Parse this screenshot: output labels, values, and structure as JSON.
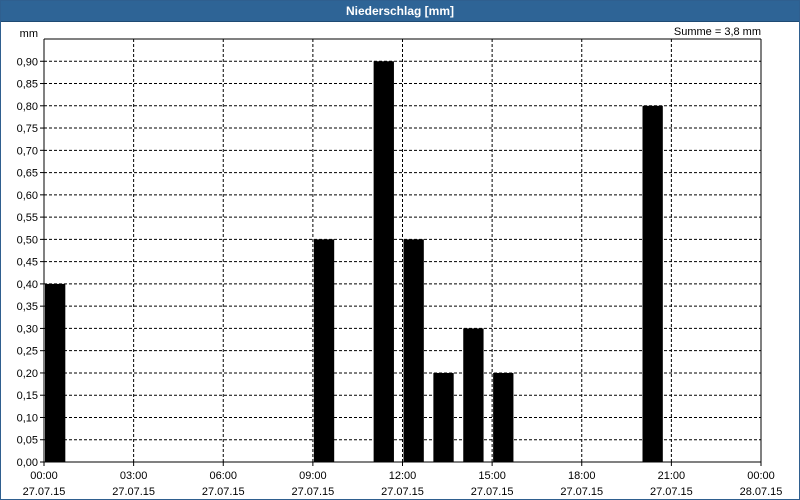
{
  "window": {
    "title": "Niederschlag [mm]"
  },
  "chart_data": {
    "type": "bar",
    "title": "Niederschlag [mm]",
    "ylabel": "mm",
    "annotation": "Summe = 3,8 mm",
    "ylim": [
      0,
      0.95
    ],
    "y_ticks": [
      "0,00",
      "0,05",
      "0,10",
      "0,15",
      "0,20",
      "0,25",
      "0,30",
      "0,35",
      "0,40",
      "0,45",
      "0,50",
      "0,55",
      "0,60",
      "0,65",
      "0,70",
      "0,75",
      "0,80",
      "0,85",
      "0,90"
    ],
    "x_ticks": [
      {
        "time": "00:00",
        "date": "27.07.15"
      },
      {
        "time": "03:00",
        "date": "27.07.15"
      },
      {
        "time": "06:00",
        "date": "27.07.15"
      },
      {
        "time": "09:00",
        "date": "27.07.15"
      },
      {
        "time": "12:00",
        "date": "27.07.15"
      },
      {
        "time": "15:00",
        "date": "27.07.15"
      },
      {
        "time": "18:00",
        "date": "27.07.15"
      },
      {
        "time": "21:00",
        "date": "27.07.15"
      },
      {
        "time": "00:00",
        "date": "28.07.15"
      }
    ],
    "x": [
      "27.07.15 00:00",
      "27.07.15 09:00",
      "27.07.15 11:00",
      "27.07.15 12:00",
      "27.07.15 13:00",
      "27.07.15 14:00",
      "27.07.15 15:00",
      "27.07.15 20:00"
    ],
    "series": [
      {
        "values": [
          0.4,
          0.5,
          0.9,
          0.5,
          0.2,
          0.3,
          0.2,
          0.8
        ],
        "color": "#000000"
      }
    ],
    "grid": true
  }
}
